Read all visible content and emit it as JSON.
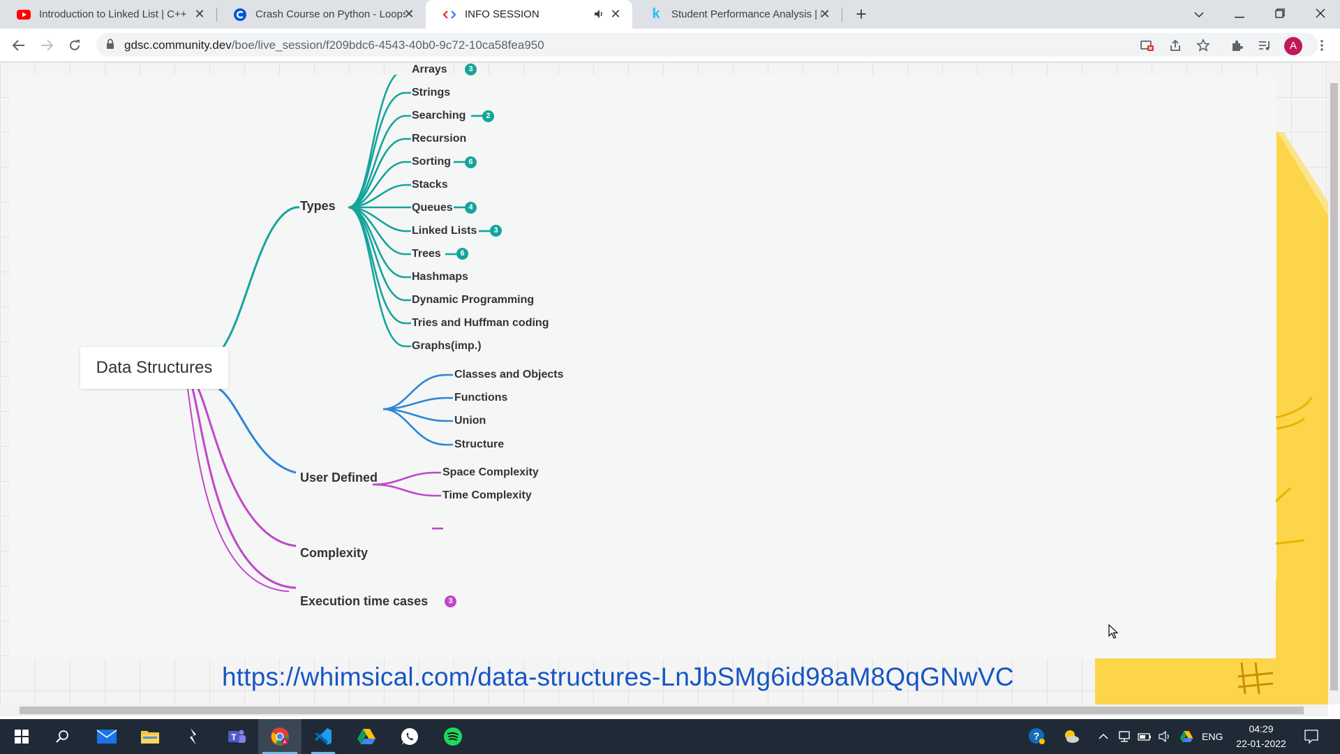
{
  "tabs": [
    {
      "title": "Introduction to Linked List | C++",
      "favicon": "youtube-icon",
      "active": false
    },
    {
      "title": "Crash Course on Python - Loops",
      "favicon": "coursera-icon",
      "active": false
    },
    {
      "title": "INFO SESSION",
      "favicon": "gdsc-icon",
      "active": true,
      "audio": true
    },
    {
      "title": "Student Performance Analysis | K",
      "favicon": "kaggle-icon",
      "active": false
    }
  ],
  "address_bar": {
    "host": "gdsc.community.dev",
    "path": "/boe/live_session/f209bdc6-4543-40b0-9c72-10ca58fea950"
  },
  "profile": {
    "initial": "A"
  },
  "mindmap": {
    "root": "Data Structures",
    "types": {
      "label": "Types",
      "children": [
        {
          "label": "Arrays",
          "badge": "3"
        },
        {
          "label": "Strings",
          "badge": ""
        },
        {
          "label": "Searching",
          "badge": "2"
        },
        {
          "label": "Recursion",
          "badge": ""
        },
        {
          "label": "Sorting",
          "badge": "6"
        },
        {
          "label": "Stacks",
          "badge": ""
        },
        {
          "label": "Queues",
          "badge": "4"
        },
        {
          "label": "Linked Lists",
          "badge": "3"
        },
        {
          "label": "Trees",
          "badge": "6"
        },
        {
          "label": "Hashmaps",
          "badge": ""
        },
        {
          "label": "Dynamic Programming",
          "badge": ""
        },
        {
          "label": "Tries and Huffman coding",
          "badge": ""
        },
        {
          "label": "Graphs(imp.)",
          "badge": ""
        }
      ]
    },
    "user_defined": {
      "label": "User Defined",
      "children": [
        {
          "label": "Classes and Objects"
        },
        {
          "label": "Functions"
        },
        {
          "label": "Union"
        },
        {
          "label": "Structure"
        }
      ]
    },
    "complexity": {
      "label": "Complexity",
      "children": [
        {
          "label": "Space Complexity"
        },
        {
          "label": "Time Complexity"
        }
      ]
    },
    "execution": {
      "label": "Execution time cases",
      "badge": "3"
    }
  },
  "link": "https://whimsical.com/data-structures-LnJbSMg6id98aM8QqGNwVC",
  "colors": {
    "teal": "#14a49a",
    "blue": "#2b86d6",
    "pink": "#c046c9",
    "accent_yellow": "#fdd54a"
  },
  "taskbar": {
    "apps": [
      "windows-start-icon",
      "search-icon",
      "mail-icon",
      "file-explorer-icon",
      "cursor-app-icon",
      "teams-icon",
      "chrome-icon",
      "vscode-icon",
      "google-drive-icon",
      "whatsapp-icon",
      "spotify-icon"
    ],
    "language": "ENG",
    "time": "04:29",
    "date": "22-01-2022"
  }
}
